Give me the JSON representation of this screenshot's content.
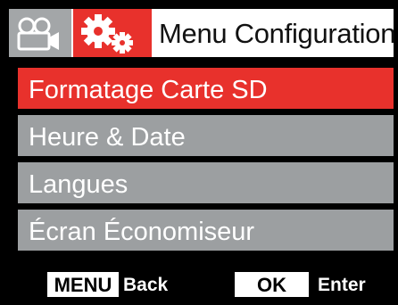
{
  "header": {
    "video_tab_icon": "video-camera-icon",
    "settings_tab_icon": "gears-icon",
    "title": "Menu Configuration"
  },
  "menu": {
    "items": [
      {
        "label": "Formatage Carte SD",
        "selected": true
      },
      {
        "label": "Heure & Date",
        "selected": false
      },
      {
        "label": "Langues",
        "selected": false
      },
      {
        "label": "Écran Économiseur",
        "selected": false
      }
    ]
  },
  "footer": {
    "menu_key": "MENU",
    "menu_action": "Back",
    "ok_key": "OK",
    "ok_action": "Enter"
  },
  "colors": {
    "accent": "#e8312c",
    "item_background": "#9c9fa1",
    "video_tab": "#a3a6a8",
    "background": "#000000"
  }
}
